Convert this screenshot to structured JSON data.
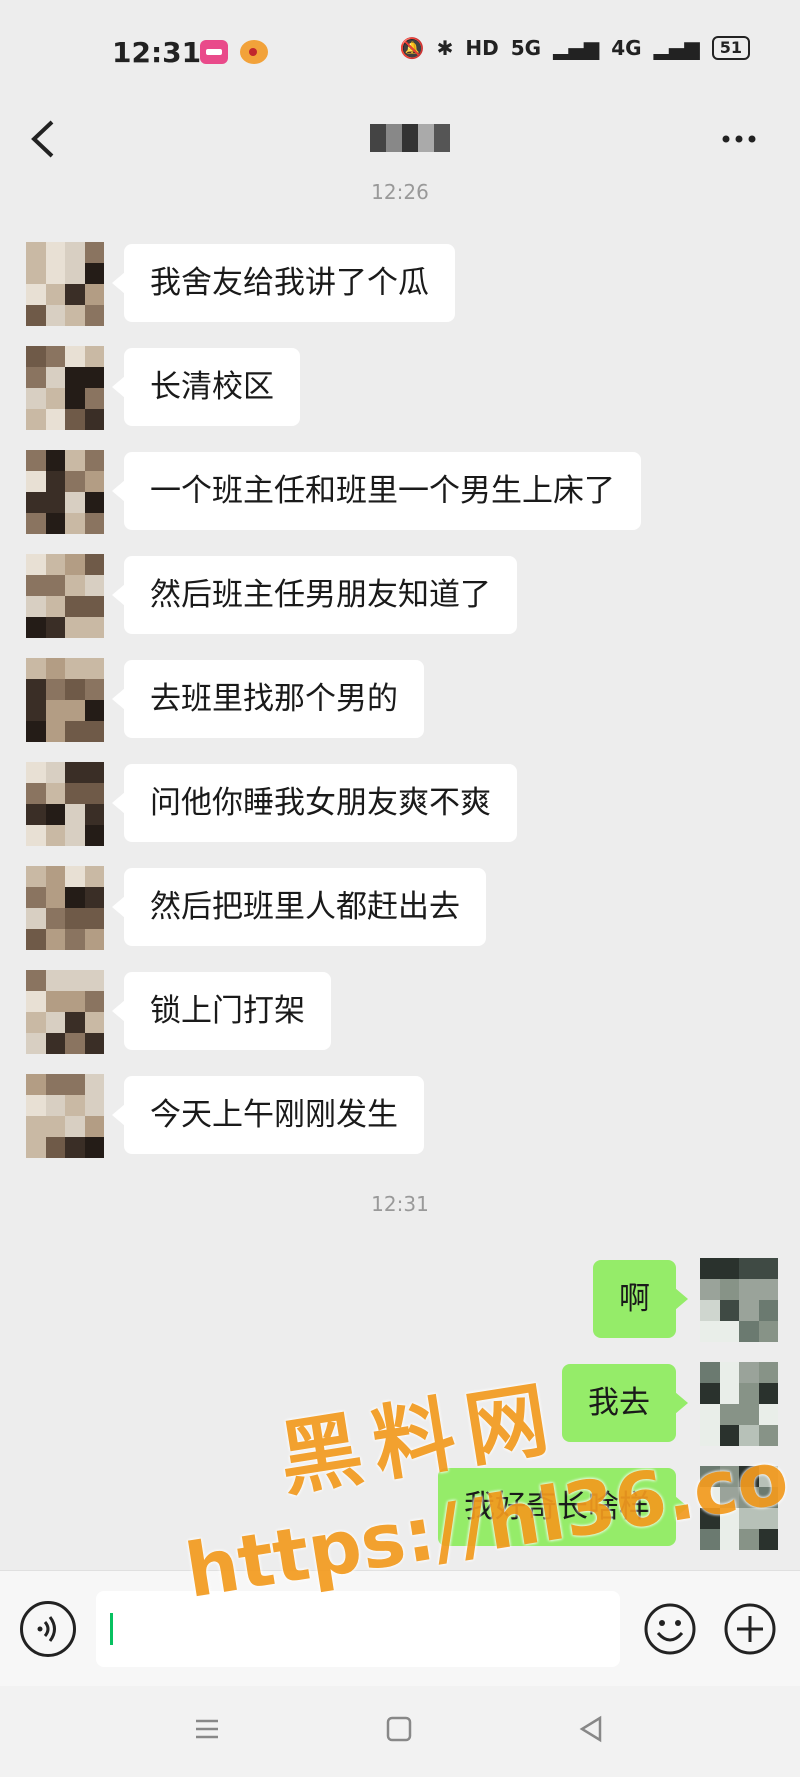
{
  "status_bar": {
    "time": "12:31",
    "network_1": "5G",
    "network_2": "4G",
    "hd_label": "HD",
    "battery": "51"
  },
  "header": {
    "contact_name_masked": ""
  },
  "timestamps": [
    "12:26",
    "12:31"
  ],
  "messages_left": [
    "我舍友给我讲了个瓜",
    "长清校区",
    "一个班主任和班里一个男生上床了",
    "然后班主任男朋友知道了",
    "去班里找那个男的",
    "问他你睡我女朋友爽不爽",
    "然后把班里人都赶出去",
    "锁上门打架",
    "今天上午刚刚发生"
  ],
  "messages_right": [
    "啊",
    "我去",
    "我好奇长啥样"
  ],
  "input": {
    "value": "",
    "placeholder": ""
  },
  "watermark": {
    "title": "黑料网",
    "url": "https://hl36.co"
  },
  "colors": {
    "background": "#ededed",
    "bubble_in": "#ffffff",
    "bubble_out": "#95ec69",
    "watermark": "#f39b1f"
  },
  "icons": [
    "back-icon",
    "more-icon",
    "voice-icon",
    "emoji-icon",
    "plus-icon",
    "nav-menu-icon",
    "nav-home-icon",
    "nav-back-icon"
  ]
}
